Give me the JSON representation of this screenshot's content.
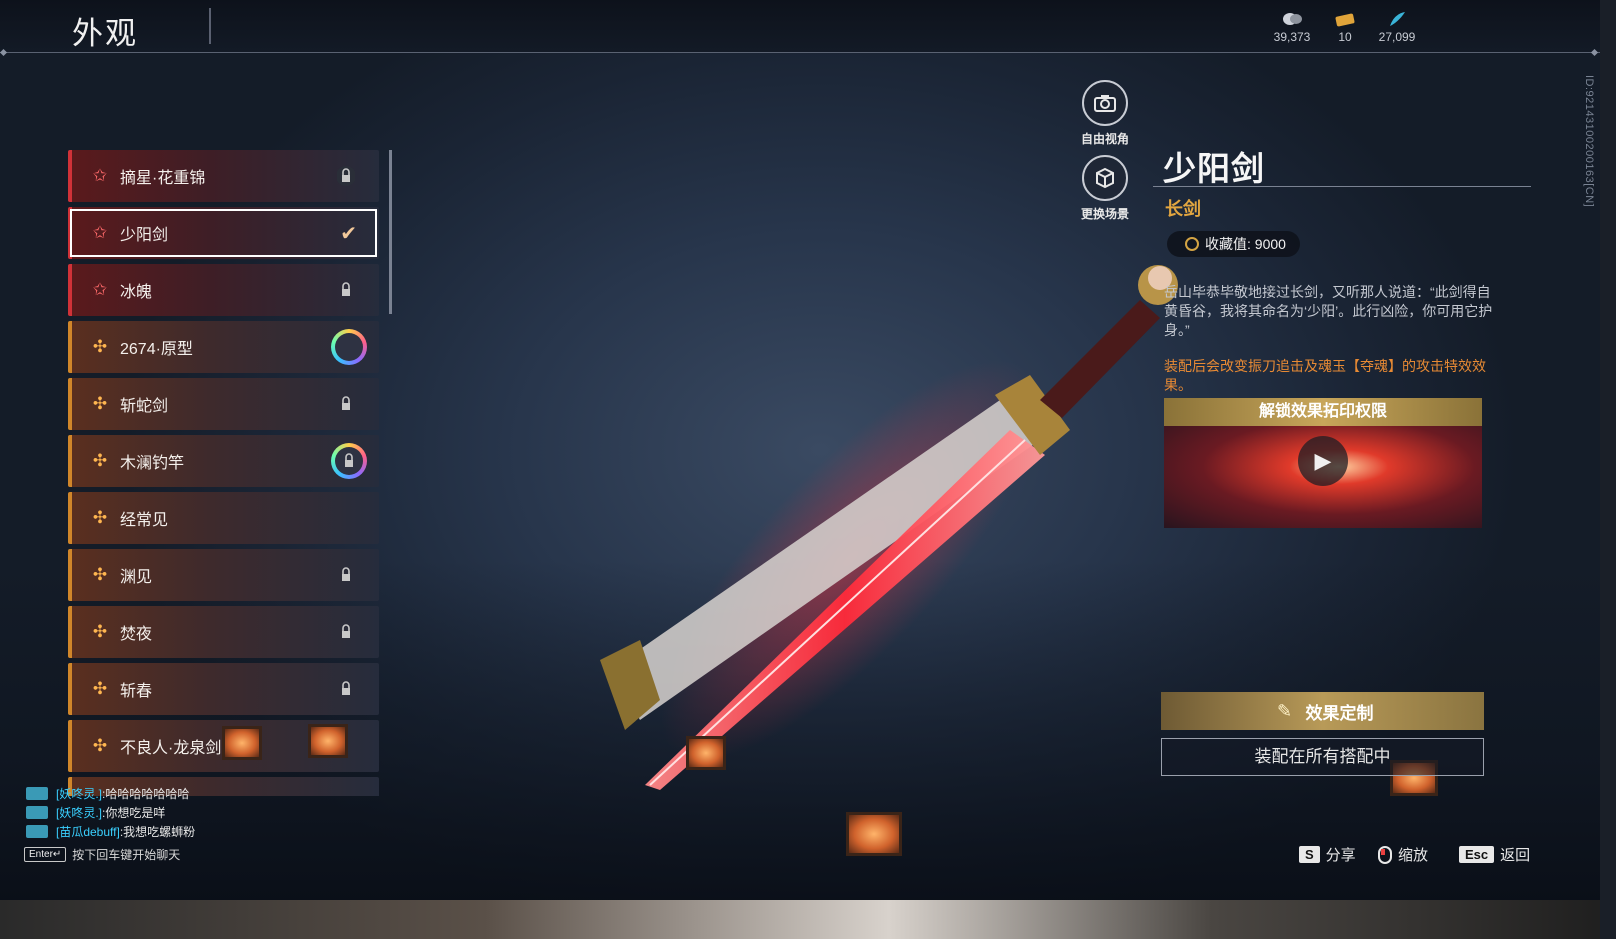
{
  "header": {
    "title": "外观",
    "currencies": [
      {
        "icon": "coin-icon",
        "value": "39,373"
      },
      {
        "icon": "ticket-icon",
        "value": "10"
      },
      {
        "icon": "feather-icon",
        "value": "27,099"
      }
    ],
    "id_text": "ID:92143100200163[CN]"
  },
  "list": {
    "items": [
      {
        "label": "摘星·花重锦",
        "rarity": "red",
        "state": "locked"
      },
      {
        "label": "少阳剑",
        "rarity": "red",
        "state": "selected"
      },
      {
        "label": "冰魄",
        "rarity": "red",
        "state": "locked"
      },
      {
        "label": "2674·原型",
        "rarity": "gold",
        "state": "ring"
      },
      {
        "label": "斩蛇剑",
        "rarity": "gold",
        "state": "locked"
      },
      {
        "label": "木澜钓竿",
        "rarity": "gold",
        "state": "ring-locked"
      },
      {
        "label": "经常见",
        "rarity": "gold",
        "state": "none"
      },
      {
        "label": "渊见",
        "rarity": "gold",
        "state": "locked"
      },
      {
        "label": "焚夜",
        "rarity": "gold",
        "state": "locked"
      },
      {
        "label": "斩春",
        "rarity": "gold",
        "state": "locked"
      },
      {
        "label": "不良人·龙泉剑",
        "rarity": "gold",
        "state": "none"
      }
    ]
  },
  "camera": {
    "free_view": "自由视角",
    "change_scene": "更换场景"
  },
  "detail": {
    "name": "少阳剑",
    "type": "长剑",
    "collection": "收藏值: 9000",
    "description": "岳山毕恭毕敬地接过长剑，又听那人说道：“此剑得自黄昏谷，我将其命名为‘少阳’。此行凶险，你可用它护身。”",
    "effect": "装配后会改变振刀追击及魂玉【夺魂】的攻击特效效果。",
    "unlock_title": "解锁效果拓印权限",
    "custom_button": "效果定制",
    "equip_button": "装配在所有搭配中"
  },
  "chat": {
    "lines": [
      {
        "who": "[妖咚灵.]",
        "text": ":哈哈哈哈哈哈哈"
      },
      {
        "who": "[妖咚灵.]",
        "text": ":你想吃是咩"
      },
      {
        "who": "[苗瓜debuff]",
        "text": ":我想吃螺蛳粉"
      }
    ],
    "enter_key": "Enter↵",
    "hint": "按下回车键开始聊天"
  },
  "footer": {
    "share_key": "S",
    "share": "分享",
    "zoom": "缩放",
    "back_key": "Esc",
    "back": "返回"
  },
  "colors": {
    "red_rarity": "#d03238",
    "gold_rarity": "#d0862a",
    "effect_text": "#e88a34",
    "type_text": "#e2a640"
  }
}
